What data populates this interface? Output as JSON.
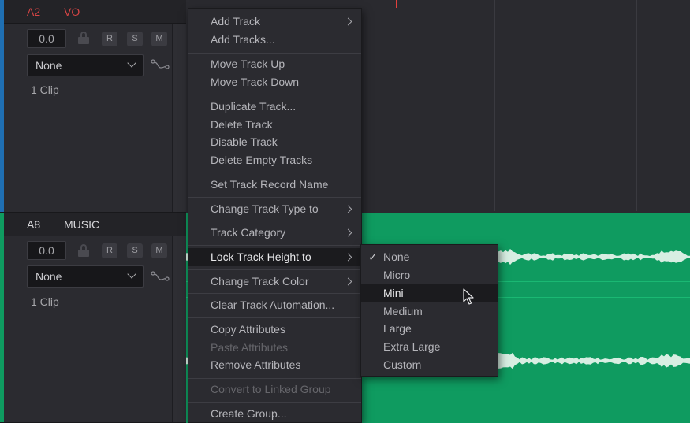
{
  "tracks": [
    {
      "id": "A2",
      "name": "VO",
      "volume": "0.0",
      "buttons": [
        "R",
        "S",
        "M"
      ],
      "select_value": "None",
      "clip_count": "1 Clip",
      "color": "#1f6fb2",
      "name_color": "#d64545"
    },
    {
      "id": "A8",
      "name": "MUSIC",
      "volume": "0.0",
      "buttons": [
        "R",
        "S",
        "M"
      ],
      "select_value": "None",
      "clip_count": "1 Clip",
      "color": "#0f9b60",
      "name_color": "#d6d6d9"
    }
  ],
  "context_menu": {
    "items": [
      {
        "label": "Add Track",
        "submenu": true
      },
      {
        "label": "Add Tracks..."
      },
      {
        "label": "Move Track Up"
      },
      {
        "label": "Move Track Down"
      },
      {
        "label": "Duplicate Track..."
      },
      {
        "label": "Delete Track"
      },
      {
        "label": "Disable Track"
      },
      {
        "label": "Delete Empty Tracks"
      },
      {
        "label": "Set Track Record Name"
      },
      {
        "label": "Change Track Type to",
        "submenu": true
      },
      {
        "label": "Track Category",
        "submenu": true
      },
      {
        "label": "Lock Track Height to",
        "submenu": true,
        "highlighted": true
      },
      {
        "label": "Change Track Color",
        "submenu": true
      },
      {
        "label": "Clear Track Automation..."
      },
      {
        "label": "Copy Attributes"
      },
      {
        "label": "Paste Attributes",
        "disabled": true
      },
      {
        "label": "Remove Attributes"
      },
      {
        "label": "Convert to Linked Group",
        "disabled": true
      },
      {
        "label": "Create Group..."
      }
    ]
  },
  "submenu": {
    "items": [
      {
        "label": "None",
        "checked": true
      },
      {
        "label": "Micro"
      },
      {
        "label": "Mini",
        "highlighted": true
      },
      {
        "label": "Medium"
      },
      {
        "label": "Large"
      },
      {
        "label": "Extra Large"
      },
      {
        "label": "Custom"
      }
    ]
  },
  "icons": {
    "lock": "lock-icon",
    "automation": "automation-curve-icon",
    "dropdown": "chevron-down-icon",
    "submenu_arrow": "chevron-right-icon",
    "check": "checkmark-icon",
    "cursor": "mouse-pointer-icon"
  },
  "colors": {
    "music_clip": "#0f9b60",
    "playhead": "#e2403d",
    "menu_bg": "#2b2b30",
    "menu_highlight": "#1b1b1e"
  }
}
